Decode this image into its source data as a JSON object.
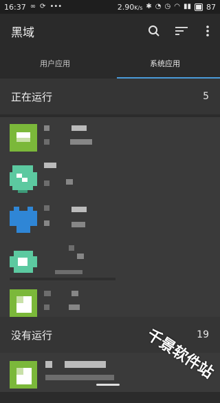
{
  "status_bar": {
    "time": "16:37",
    "speed": "2.90",
    "speed_unit": "K/s",
    "battery": "87"
  },
  "header": {
    "title": "黑域"
  },
  "tabs": [
    {
      "label": "用户应用",
      "active": false
    },
    {
      "label": "系统应用",
      "active": true
    }
  ],
  "sections": {
    "running": {
      "label": "正在运行",
      "count": "5"
    },
    "not_running": {
      "label": "没有运行",
      "count": "19"
    }
  },
  "watermark": "千景软件站",
  "colors": {
    "accent": "#4a9bd9",
    "icon_green": "#7bb83a",
    "icon_teal": "#5cc9a0",
    "icon_blue": "#2f86d6"
  }
}
